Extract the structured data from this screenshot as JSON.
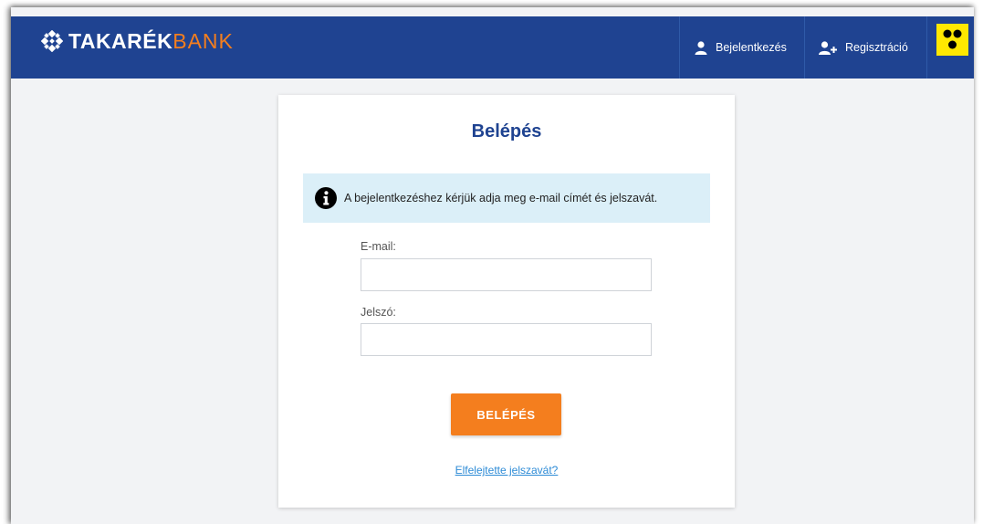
{
  "header": {
    "logo": {
      "part1": "TAKARÉK",
      "part2": "BANK"
    },
    "nav": [
      {
        "label": "Bejelentkezés",
        "icon": "user-icon"
      },
      {
        "label": "Regisztráció",
        "icon": "add-user-icon"
      }
    ],
    "accessibility_icon": "low-vision-icon"
  },
  "login": {
    "title": "Belépés",
    "info_text": "A bejelentkezéshez kérjük adja meg e-mail címét és jelszavát.",
    "email_label": "E-mail:",
    "email_value": "",
    "password_label": "Jelszó:",
    "password_value": "",
    "submit_label": "BELÉPÉS",
    "forgot_link": "Elfelejtette jelszavát?"
  },
  "colors": {
    "header_bg": "#1f4391",
    "accent_orange": "#f47e1e",
    "info_bg": "#dbeff8",
    "accessibility_yellow": "#ffe800"
  }
}
